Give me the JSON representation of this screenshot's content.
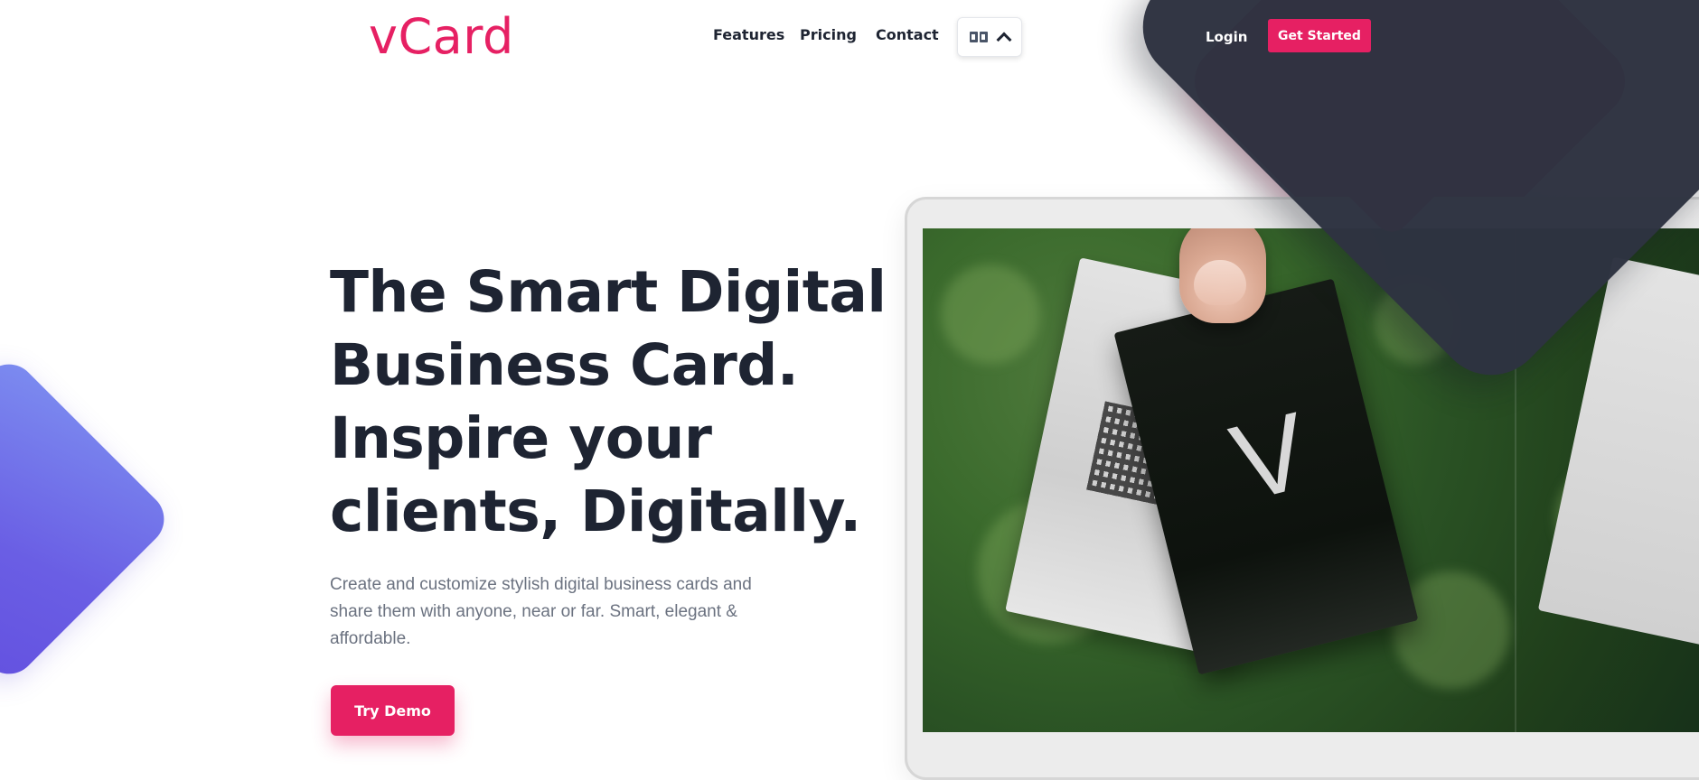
{
  "brand": {
    "logo_text": "vCard",
    "accent_color": "#e62063",
    "dark_color": "#2e3341",
    "purple_color": "#6a5ee4"
  },
  "nav": {
    "links": [
      "Features",
      "Pricing",
      "Contact"
    ],
    "language_icon": "translate-icon",
    "language_chevron": "chevron-up-icon",
    "login": "Login",
    "get_started": "Get Started"
  },
  "hero": {
    "title_lines": [
      "The Smart Digital",
      "Business Card.",
      "Inspire your",
      "clients, Digitally."
    ],
    "subtitle_lines": [
      "Create and customize stylish digital business cards and",
      "share them with anyone, near or far. Smart, elegant &",
      "affordable."
    ],
    "cta": "Try Demo"
  },
  "mockup": {
    "card_letter": "V"
  }
}
